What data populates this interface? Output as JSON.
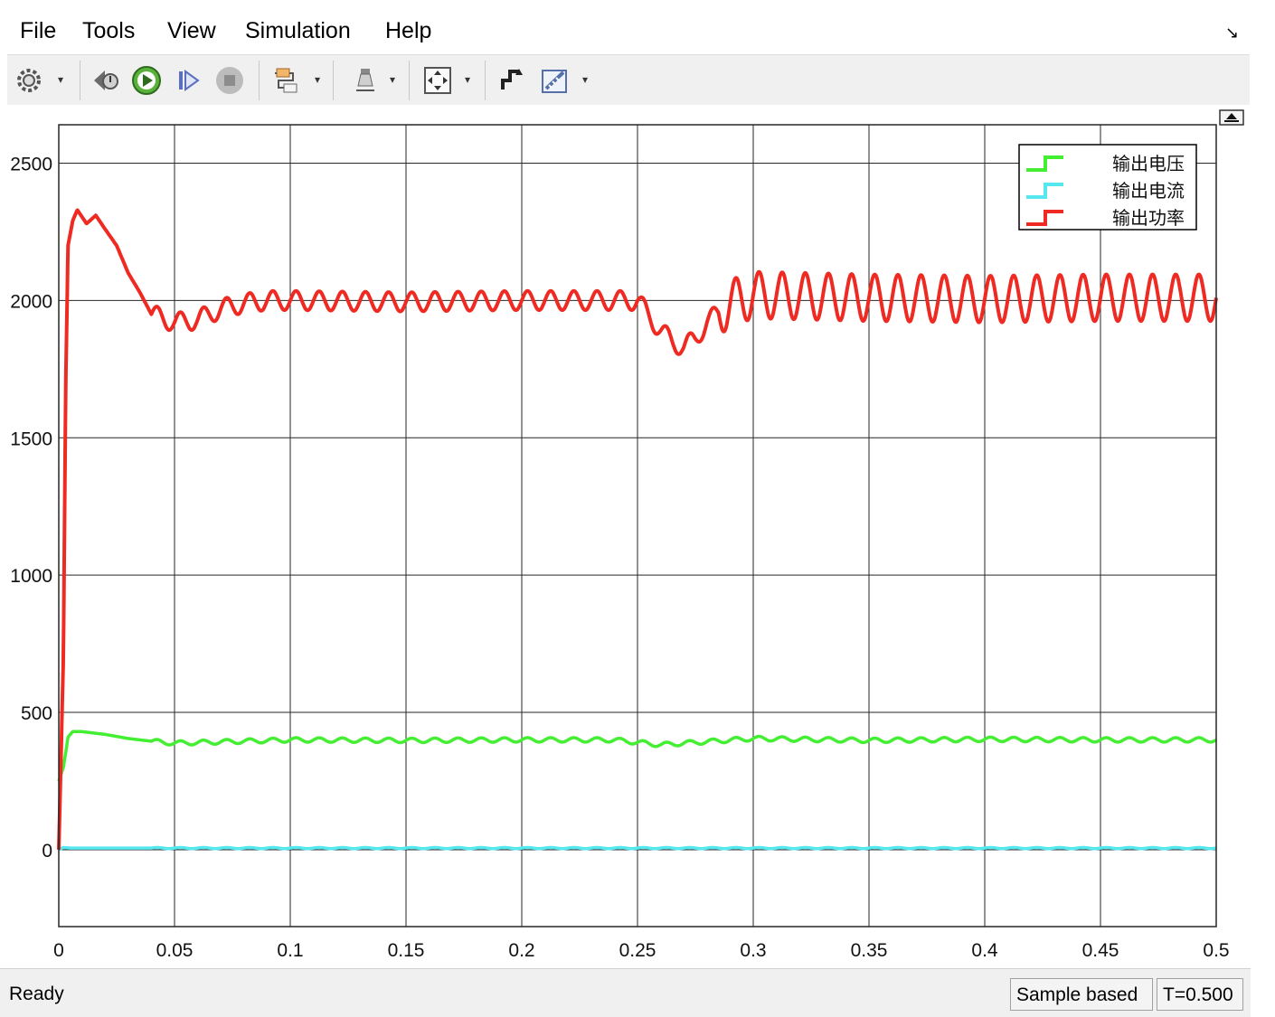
{
  "menu": [
    "File",
    "Tools",
    "View",
    "Simulation",
    "Help"
  ],
  "toolbar_icons": [
    "settings-icon",
    "step-back-icon",
    "run-icon",
    "step-forward-icon",
    "stop-icon",
    "signal-select-icon",
    "highlight-icon",
    "zoom-fit-icon",
    "triggers-icon",
    "measurements-icon"
  ],
  "colors": {
    "voltage": "#44ee33",
    "current": "#55e8ee",
    "power": "#ee2a22",
    "grid": "#262626"
  },
  "status": {
    "left": "Ready",
    "mode": "Sample based",
    "time": "T=0.500"
  },
  "chart_data": {
    "type": "line",
    "xlabel": "",
    "ylabel": "",
    "xlim": [
      0,
      0.5
    ],
    "ylim": [
      -280,
      2640
    ],
    "xticks": [
      "0",
      "0.05",
      "0.1",
      "0.15",
      "0.2",
      "0.25",
      "0.3",
      "0.35",
      "0.4",
      "0.45",
      "0.5"
    ],
    "yticks": [
      "0",
      "500",
      "1000",
      "1500",
      "2000",
      "2500"
    ],
    "grid": true,
    "legend_position": "top-right",
    "series": [
      {
        "name": "输出电压",
        "color": "#44ee33",
        "x": [
          0,
          0.002,
          0.004,
          0.006,
          0.01,
          0.015,
          0.02,
          0.03,
          0.04,
          0.05,
          0.1,
          0.15,
          0.2,
          0.24,
          0.26,
          0.27,
          0.3,
          0.35,
          0.4,
          0.45,
          0.5
        ],
        "y": [
          250,
          300,
          410,
          430,
          430,
          425,
          420,
          405,
          395,
          388,
          400,
          398,
          400,
          400,
          382,
          388,
          405,
          398,
          402,
          400,
          400
        ],
        "ripple": 8,
        "ripple_period": 0.01
      },
      {
        "name": "输出电流",
        "color": "#55e8ee",
        "x": [
          0,
          0.002,
          0.005,
          0.5
        ],
        "y": [
          0,
          8,
          6,
          6
        ],
        "ripple": 2,
        "ripple_period": 0.01
      },
      {
        "name": "输出功率",
        "color": "#ee2a22",
        "x": [
          0,
          0.002,
          0.003,
          0.004,
          0.006,
          0.008,
          0.012,
          0.016,
          0.02,
          0.025,
          0.03,
          0.035,
          0.04,
          0.05,
          0.06,
          0.07,
          0.08,
          0.09,
          0.1,
          0.15,
          0.2,
          0.25,
          0.26,
          0.265,
          0.27,
          0.275,
          0.28,
          0.29,
          0.3,
          0.35,
          0.4,
          0.45,
          0.5
        ],
        "y": [
          0,
          700,
          1700,
          2200,
          2290,
          2330,
          2280,
          2310,
          2260,
          2200,
          2100,
          2030,
          1950,
          1920,
          1930,
          1970,
          1990,
          2000,
          2000,
          1995,
          2000,
          2000,
          1890,
          1850,
          1830,
          1860,
          1920,
          1990,
          2020,
          2010,
          2005,
          2010,
          2010
        ],
        "ripple": 35,
        "ripple_period": 0.01,
        "ripple_late": 85
      }
    ]
  }
}
